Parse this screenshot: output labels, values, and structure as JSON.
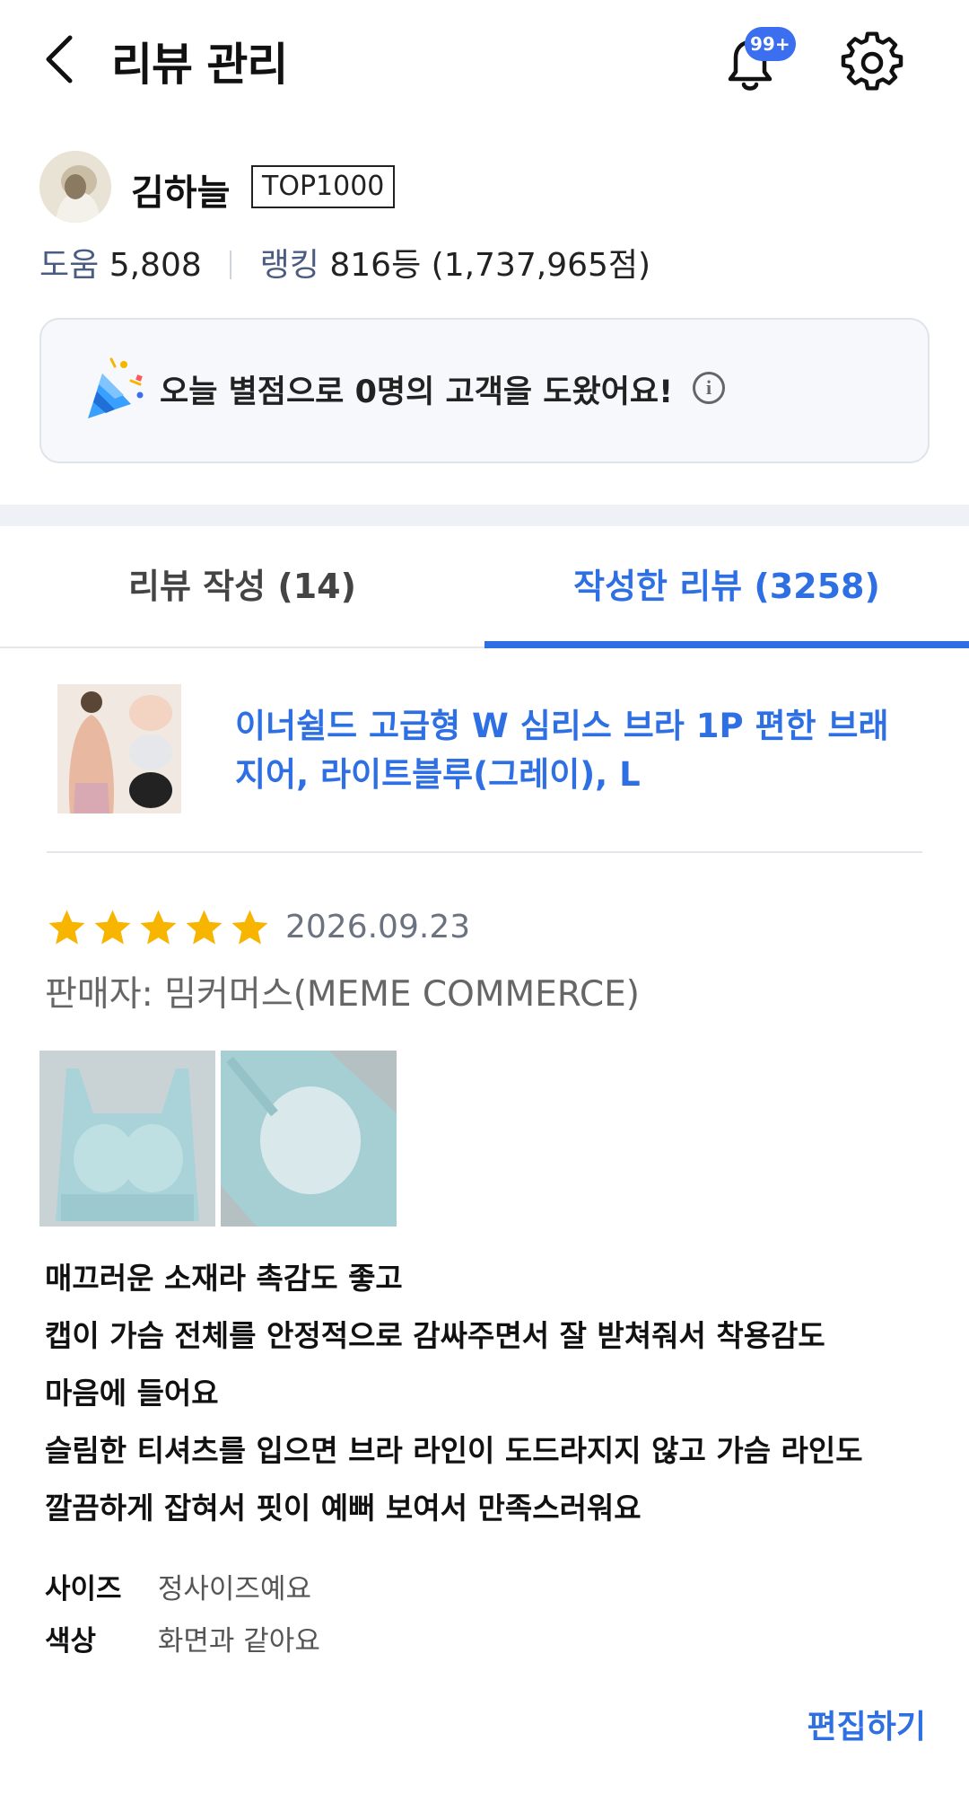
{
  "header": {
    "title": "리뷰 관리",
    "notification_badge": "99+"
  },
  "profile": {
    "name": "김하늘",
    "rank_badge": "TOP1000",
    "help_label": "도움",
    "help_value": "5,808",
    "ranking_label": "랭킹",
    "ranking_value": "816등 (1,737,965점)"
  },
  "notice": {
    "text": "오늘 별점으로 0명의 고객을 도왔어요!",
    "info_symbol": "i"
  },
  "tabs": [
    {
      "label": "리뷰 작성 (14)",
      "active": false
    },
    {
      "label": "작성한 리뷰 (3258)",
      "active": true
    }
  ],
  "product": {
    "title": "이너쉴드 고급형 W 심리스 브라 1P 편한 브래지어, 라이트블루(그레이), L"
  },
  "review": {
    "rating": 5,
    "date": "2026.09.23",
    "seller": "판매자: 밈커머스(MEME COMMERCE)",
    "body_lines": [
      "매끄러운 소재라 촉감도 좋고",
      "캡이 가슴 전체를 안정적으로 감싸주면서 잘 받쳐줘서 착용감도",
      "마음에 들어요",
      "슬림한 티셔츠를 입으면 브라 라인이 도드라지지 않고 가슴 라인도",
      "깔끔하게 잡혀서 핏이 예뻐 보여서 만족스러워요"
    ],
    "attributes": [
      {
        "key": "사이즈",
        "value": "정사이즈예요"
      },
      {
        "key": "색상",
        "value": "화면과 같아요"
      }
    ],
    "edit_label": "편집하기"
  },
  "colors": {
    "accent_blue": "#2f6fe4",
    "star_yellow": "#f7b500",
    "badge_blue": "#3b6ff0"
  },
  "icons": [
    "back-arrow-icon",
    "bell-icon",
    "gear-icon",
    "party-popper-icon",
    "info-icon",
    "star-icon"
  ]
}
